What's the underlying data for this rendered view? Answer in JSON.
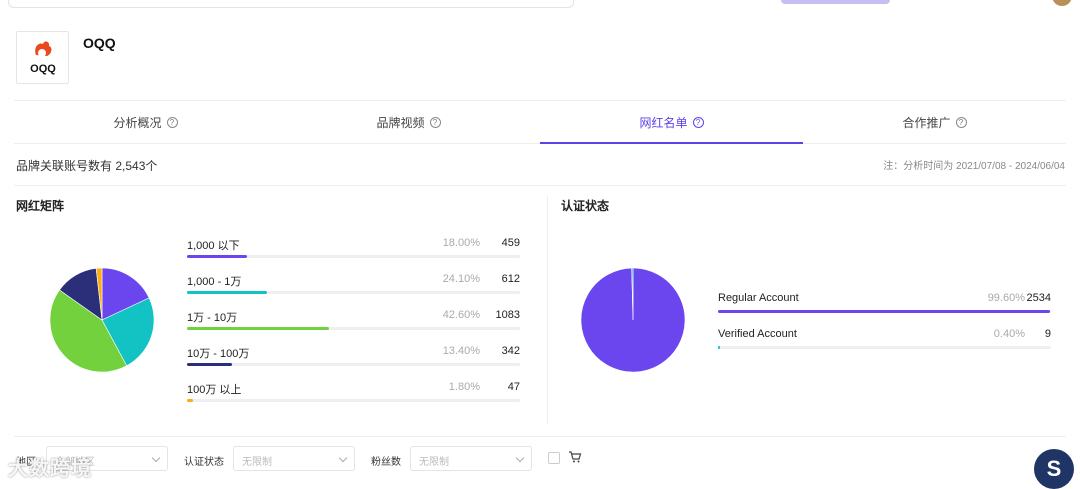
{
  "brand": {
    "name": "OQQ",
    "logo_text": "OQQ"
  },
  "tabs": [
    {
      "label": "分析概况",
      "active": false
    },
    {
      "label": "品牌视频",
      "active": false
    },
    {
      "label": "网红名单",
      "active": true
    },
    {
      "label": "合作推广",
      "active": false
    }
  ],
  "summary": {
    "text": "品牌关联账号数有 2,543个",
    "note": "注：分析时间为 2021/07/08 - 2024/06/04"
  },
  "matrix": {
    "title": "网红矩阵",
    "rows": [
      {
        "label": "1,000 以下",
        "percent": "18.00%",
        "count": "459",
        "value": 18.0,
        "color": "#6b45ee"
      },
      {
        "label": "1,000 - 1万",
        "percent": "24.10%",
        "count": "612",
        "value": 24.1,
        "color": "#13c2c2"
      },
      {
        "label": "1万 - 10万",
        "percent": "42.60%",
        "count": "1083",
        "value": 42.6,
        "color": "#73d13d"
      },
      {
        "label": "10万 - 100万",
        "percent": "13.40%",
        "count": "342",
        "value": 13.4,
        "color": "#2b2f7a"
      },
      {
        "label": "100万 以上",
        "percent": "1.80%",
        "count": "47",
        "value": 1.8,
        "color": "#faad14"
      }
    ]
  },
  "verification": {
    "title": "认证状态",
    "rows": [
      {
        "label": "Regular Account",
        "percent": "99.60%",
        "count": "2534",
        "value": 99.6,
        "color": "#6b45ee"
      },
      {
        "label": "Verified Account",
        "percent": "0.40%",
        "count": "9",
        "value": 0.4,
        "color": "#13c2c2"
      }
    ]
  },
  "filters": {
    "region_label": "地区",
    "region_placeholder": "全部地区",
    "verify_label": "认证状态",
    "verify_placeholder": "无限制",
    "fans_label": "粉丝数",
    "fans_placeholder": "无限制"
  },
  "watermark": "大数跨境",
  "badge": "S",
  "icons": [
    "question-circle-icon",
    "chevron-down-icon",
    "cart-icon",
    "checkbox-icon"
  ]
}
